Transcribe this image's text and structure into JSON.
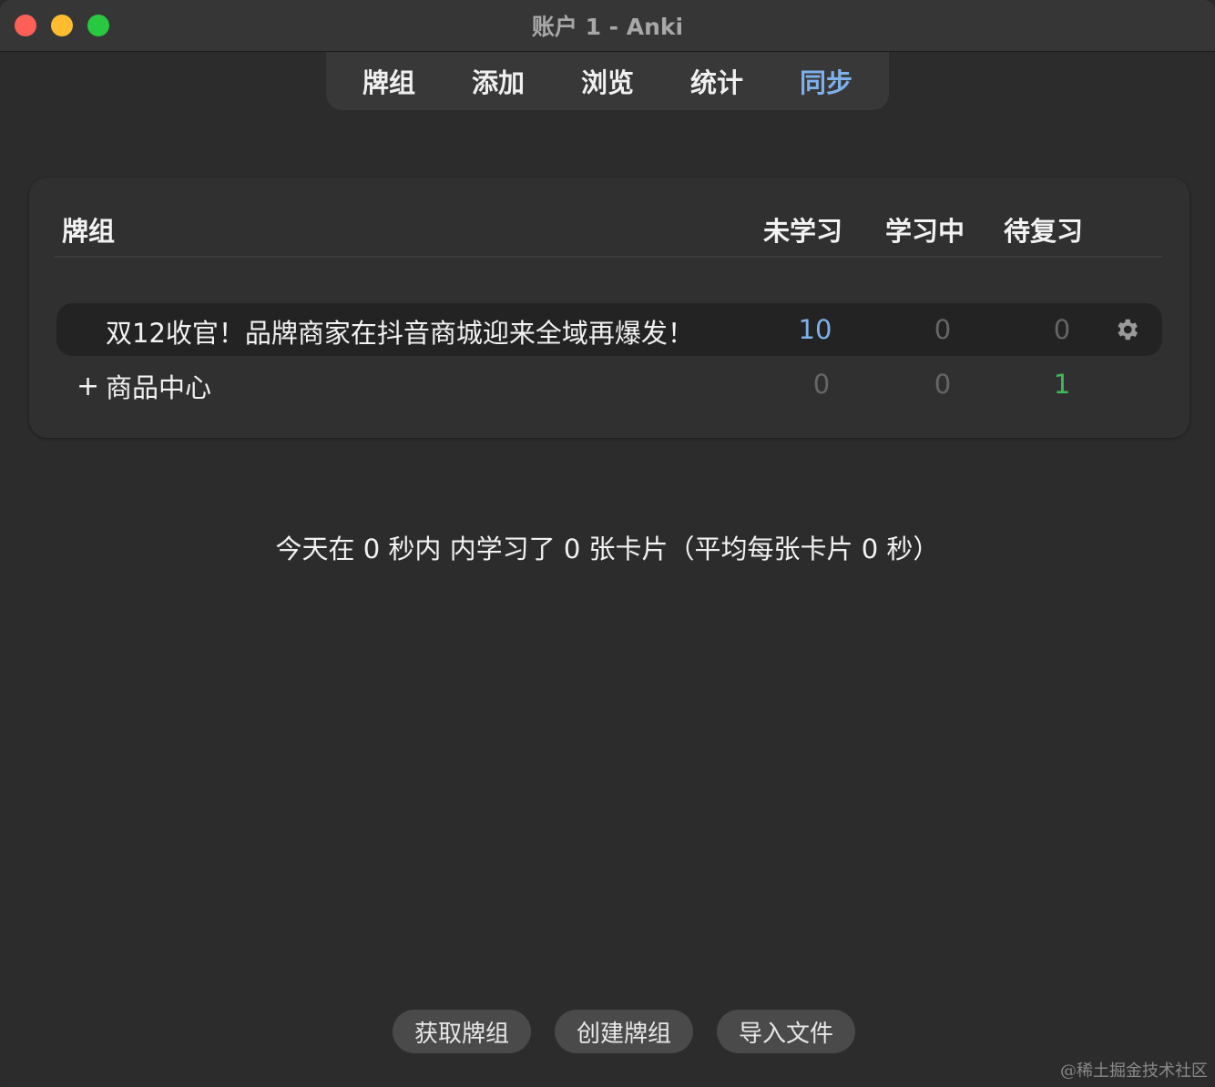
{
  "window": {
    "title": "账户 1 - Anki"
  },
  "toolbar": {
    "items": [
      {
        "label": "牌组"
      },
      {
        "label": "添加"
      },
      {
        "label": "浏览"
      },
      {
        "label": "统计"
      },
      {
        "label": "同步",
        "active": true
      }
    ]
  },
  "deck_table": {
    "headers": {
      "deck": "牌组",
      "new": "未学习",
      "learn": "学习中",
      "due": "待复习"
    },
    "rows": [
      {
        "name": "双12收官！品牌商家在抖音商城迎来全域再爆发！",
        "new": "10",
        "learn": "0",
        "due": "0",
        "selected": true
      },
      {
        "expander": "+",
        "name": "商品中心",
        "new": "0",
        "learn": "0",
        "due": "1"
      }
    ]
  },
  "stats_text": "今天在 0 秒内 内学习了 0 张卡片（平均每张卡片 0 秒）",
  "bottom_buttons": {
    "get_shared": "获取牌组",
    "create_deck": "创建牌组",
    "import_file": "导入文件"
  },
  "watermark": "@稀土掘金技术社区",
  "colors": {
    "accent_blue": "#7fb0ea",
    "due_green": "#3fba5a",
    "muted_grey": "#666666"
  },
  "icons": {
    "deck_options": "gear-icon"
  }
}
